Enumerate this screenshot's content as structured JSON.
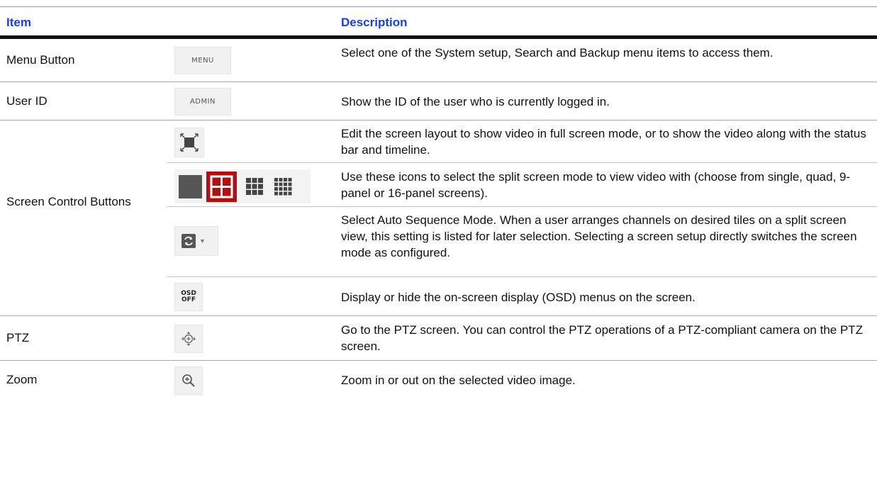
{
  "header": {
    "item": "Item",
    "description": "Description"
  },
  "rows": [
    {
      "item": "Menu Button",
      "icon_text": "MENU",
      "icon": "menu-button-icon",
      "description": "Select one of the System setup, Search and Backup menu items to access them."
    },
    {
      "item": "User ID",
      "icon_text": "ADMIN",
      "icon": "admin-id-icon",
      "description": "Show the ID of the user who is currently logged in."
    }
  ],
  "screen_control": {
    "item": "Screen Control Buttons",
    "subs": [
      {
        "icon": "fullscreen-icon",
        "description": "Edit the screen layout to show video in full screen mode, or to show the video along with the status bar and timeline."
      },
      {
        "icons": [
          "single-split-icon",
          "quad-split-icon",
          "nine-split-icon",
          "sixteen-split-icon"
        ],
        "description": "Use these icons to select the split screen mode to view video with (choose from single, quad, 9-panel or 16-panel screens)."
      },
      {
        "icon": "auto-sequence-icon",
        "description": "Select Auto Sequence Mode. When a user arranges channels on desired tiles on a split screen view, this setting is listed for later selection. Selecting a screen setup directly switches the screen mode as configured."
      },
      {
        "icon": "osd-off-icon",
        "icon_text_top": "OSD",
        "icon_text_bottom": "OFF",
        "description": "Display or hide the on-screen display (OSD) menus on the screen."
      }
    ]
  },
  "rows_bottom": [
    {
      "item": "PTZ",
      "icon": "ptz-move-icon",
      "description": "Go to the PTZ screen. You can control the PTZ operations of a PTZ-compliant camera on the PTZ screen."
    },
    {
      "item": "Zoom",
      "icon": "zoom-in-icon",
      "description": "Zoom in or out on the selected video image."
    }
  ],
  "colors": {
    "header_text": "#1a3fe0",
    "active_split": "#b01010",
    "icon_dark": "#444444"
  }
}
